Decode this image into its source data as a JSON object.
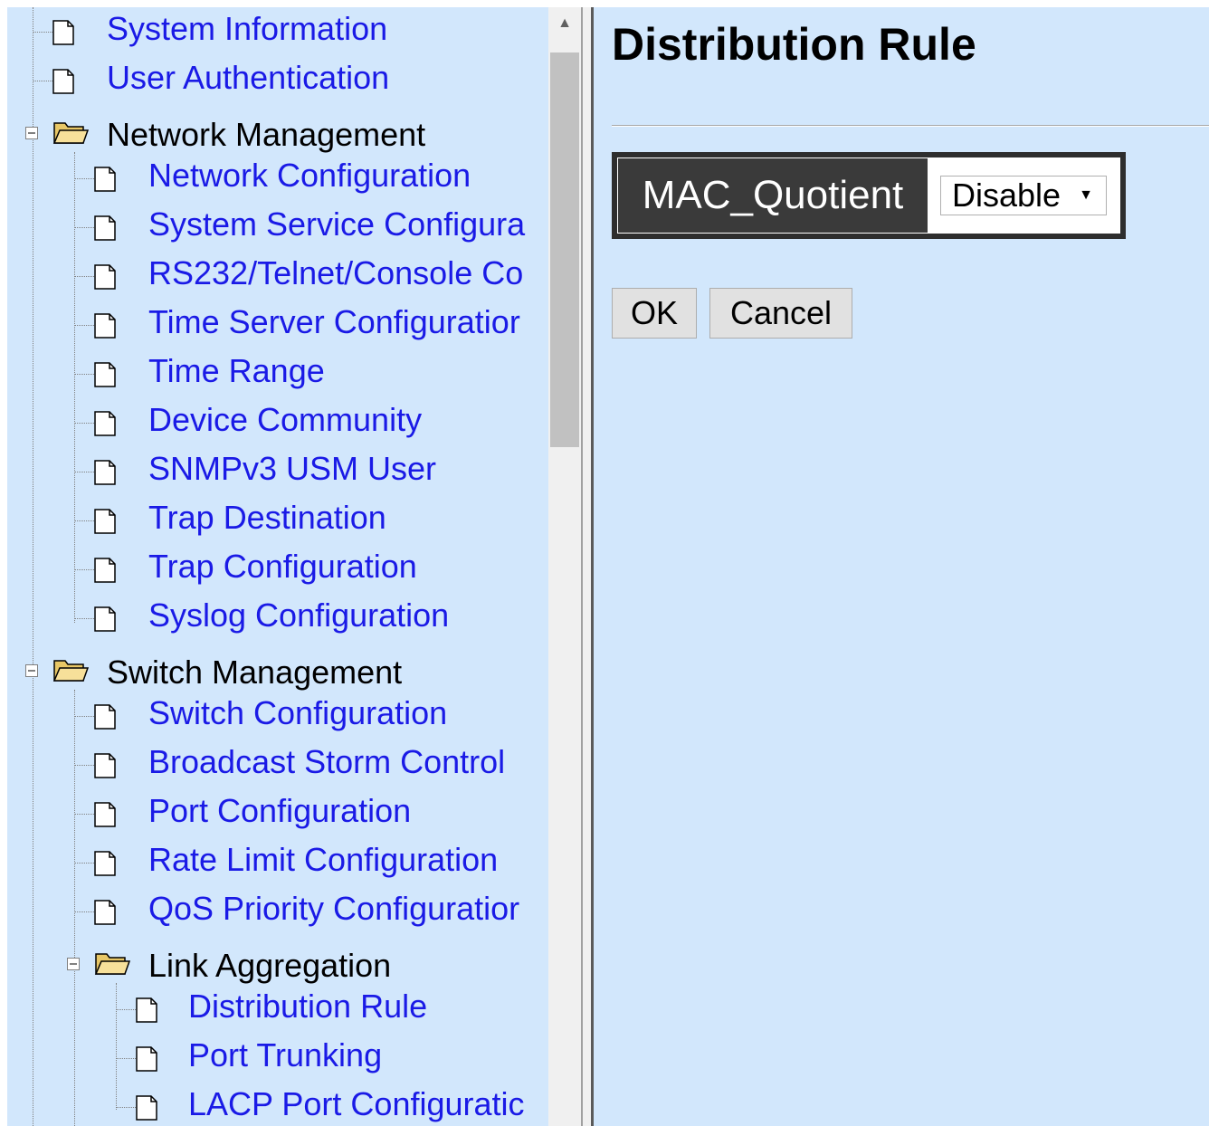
{
  "tree": {
    "system_information": "System Information",
    "user_authentication": "User Authentication",
    "network_management": {
      "label": "Network Management",
      "items": [
        "Network Configuration",
        "System Service Configura",
        "RS232/Telnet/Console Co",
        "Time Server Configuratior",
        "Time Range",
        "Device Community",
        "SNMPv3 USM User",
        "Trap Destination",
        "Trap Configuration",
        "Syslog Configuration"
      ]
    },
    "switch_management": {
      "label": "Switch Management",
      "items": [
        "Switch Configuration",
        "Broadcast Storm Control",
        "Port Configuration",
        "Rate Limit Configuration",
        "QoS Priority Configuratior"
      ],
      "link_aggregation": {
        "label": "Link Aggregation",
        "items": [
          "Distribution Rule",
          "Port Trunking",
          "LACP Port Configuratic"
        ]
      }
    }
  },
  "main": {
    "title": "Distribution Rule",
    "field_label": "MAC_Quotient",
    "select_value": "Disable",
    "ok_label": "OK",
    "cancel_label": "Cancel"
  },
  "colors": {
    "panel_background": "#d2e7fc",
    "link": "#1a1ae6",
    "table_header": "#3a3a3a"
  }
}
